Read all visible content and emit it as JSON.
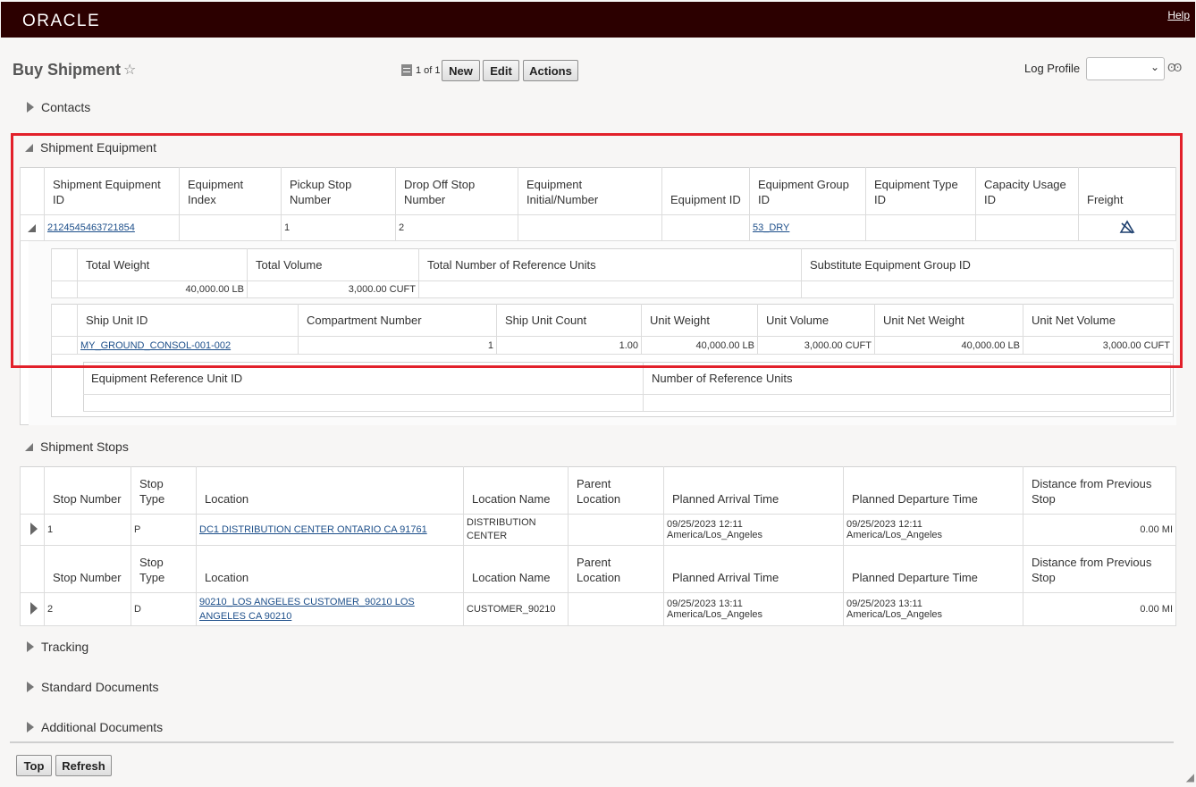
{
  "app": {
    "logo": "ORACLE",
    "help": "Help"
  },
  "page": {
    "title": "Buy Shipment",
    "star": "☆",
    "record_count": "1 of 1",
    "buttons": {
      "new": "New",
      "edit": "Edit",
      "actions": "Actions"
    },
    "log_profile_label": "Log Profile",
    "log_profile_value": "",
    "glasses": "Ꙭ"
  },
  "sections": {
    "contacts": "Contacts",
    "shipment_equipment": "Shipment Equipment",
    "shipment_stops": "Shipment Stops",
    "tracking": "Tracking",
    "standard_documents": "Standard Documents",
    "additional_documents": "Additional Documents"
  },
  "equipment": {
    "headers": [
      "Shipment Equipment ID",
      "Equipment Index",
      "Pickup Stop Number",
      "Drop Off Stop Number",
      "Equipment Initial/Number",
      "Equipment ID",
      "Equipment Group ID",
      "Equipment Type ID",
      "Capacity Usage ID",
      "Freight"
    ],
    "row": {
      "shipment_equipment_id": "2124545463721854",
      "equipment_index": "",
      "pickup_stop": "1",
      "drop_off_stop": "2",
      "initial_number": "",
      "equipment_id": "",
      "equipment_group_id": "53_DRY",
      "equipment_type_id": "",
      "capacity_usage_id": "",
      "freight_icon": "freight-icon"
    },
    "totals_headers": [
      "Total Weight",
      "Total Volume",
      "Total Number of Reference Units",
      "Substitute Equipment Group ID"
    ],
    "totals_row": {
      "total_weight": "40,000.00 LB",
      "total_volume": "3,000.00 CUFT",
      "total_ref_units": "",
      "substitute_group": ""
    },
    "ship_unit_headers": [
      "Ship Unit ID",
      "Compartment Number",
      "Ship Unit Count",
      "Unit Weight",
      "Unit Volume",
      "Unit Net Weight",
      "Unit Net Volume"
    ],
    "ship_unit_row": {
      "ship_unit_id": "MY_GROUND_CONSOL-001-002",
      "compartment": "1",
      "count": "1.00",
      "unit_weight": "40,000.00 LB",
      "unit_volume": "3,000.00 CUFT",
      "unit_net_weight": "40,000.00 LB",
      "unit_net_volume": "3,000.00 CUFT"
    },
    "ref_unit_headers": [
      "Equipment Reference Unit ID",
      "Number of Reference Units"
    ]
  },
  "stops": {
    "headers": [
      "Stop Number",
      "Stop Type",
      "Location",
      "Location Name",
      "Parent Location",
      "Planned Arrival Time",
      "Planned Departure Time",
      "Distance from Previous Stop"
    ],
    "rows": [
      {
        "stop_number": "1",
        "stop_type": "P",
        "location": "DC1 DISTRIBUTION CENTER ONTARIO CA 91761",
        "location_name": "DISTRIBUTION CENTER",
        "parent_location": "",
        "arrival": "09/25/2023 12:11 America/Los_Angeles",
        "departure": "09/25/2023 12:11 America/Los_Angeles",
        "distance": "0.00 MI"
      },
      {
        "stop_number": "2",
        "stop_type": "D",
        "location": "90210_LOS ANGELES CUSTOMER_90210 LOS ANGELES CA 90210",
        "location_name": "CUSTOMER_90210",
        "parent_location": "",
        "arrival": "09/25/2023 13:11 America/Los_Angeles",
        "departure": "09/25/2023 13:11 America/Los_Angeles",
        "distance": "0.00 MI"
      }
    ]
  },
  "footer": {
    "top": "Top",
    "refresh": "Refresh"
  }
}
